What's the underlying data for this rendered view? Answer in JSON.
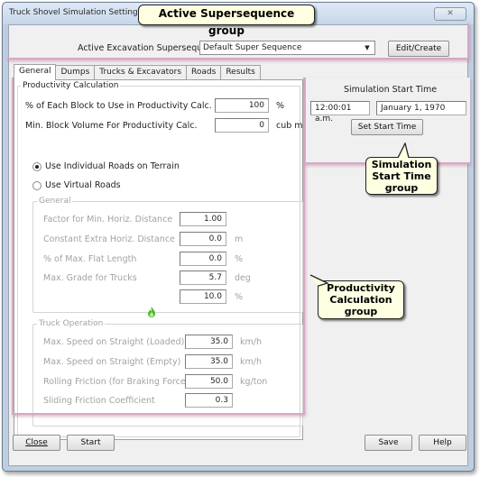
{
  "window": {
    "title": "Truck Shovel Simulation Settings",
    "close_glyph": "✕"
  },
  "supersequence": {
    "label": "Active Excavation Supersequence",
    "selected": "Default Super Sequence",
    "edit_button": "Edit/Create"
  },
  "tabs": [
    {
      "label": "General",
      "active": true
    },
    {
      "label": "Dumps"
    },
    {
      "label": "Trucks & Excavators"
    },
    {
      "label": "Roads"
    },
    {
      "label": "Results"
    }
  ],
  "productivity": {
    "title": "Productivity Calculation",
    "rows": [
      {
        "label": "% of Each Block to Use in Productivity Calc.",
        "value": "100",
        "unit": "%"
      },
      {
        "label": "Min. Block Volume For Productivity Calc.",
        "value": "0",
        "unit": "cub m"
      }
    ],
    "radio_individual": "Use Individual Roads on Terrain",
    "radio_virtual": "Use Virtual Roads",
    "selected_radio": "individual",
    "general": {
      "title": "General",
      "rows": [
        {
          "label": "Factor for Min. Horiz. Distance",
          "value": "1.00",
          "unit": ""
        },
        {
          "label": "Constant Extra Horiz. Distance",
          "value": "0.0",
          "unit": "m"
        },
        {
          "label": "% of Max. Flat Length",
          "value": "0.0",
          "unit": "%"
        },
        {
          "label": "Max. Grade for Trucks",
          "value": "5.7",
          "unit": "deg"
        },
        {
          "label": "",
          "value": "10.0",
          "unit": "%"
        }
      ]
    },
    "truck_operation": {
      "title": "Truck Operation",
      "rows": [
        {
          "label": "Max. Speed on Straight (Loaded)",
          "value": "35.0",
          "unit": "km/h"
        },
        {
          "label": "Max. Speed on Straight (Empty)",
          "value": "35.0",
          "unit": "km/h"
        },
        {
          "label": "Rolling Friction (for Braking Force)",
          "value": "50.0",
          "unit": "kg/ton"
        },
        {
          "label": "Sliding Friction Coefficient",
          "value": "0.3",
          "unit": ""
        }
      ]
    }
  },
  "start_time": {
    "title": "Simulation Start Time",
    "time": "12:00:01 a.m.",
    "date": "January 1, 1970",
    "button": "Set Start Time"
  },
  "footer": {
    "close": "Close",
    "start": "Start",
    "save": "Save",
    "help": "Help"
  },
  "callouts": {
    "supersequence": "Active Supersequence group",
    "start_time": "Simulation Start Time group",
    "productivity": "Productivity Calculation group"
  },
  "colors": {
    "highlight": "#d5a9c2",
    "callout_bg": "#ffffe1"
  }
}
